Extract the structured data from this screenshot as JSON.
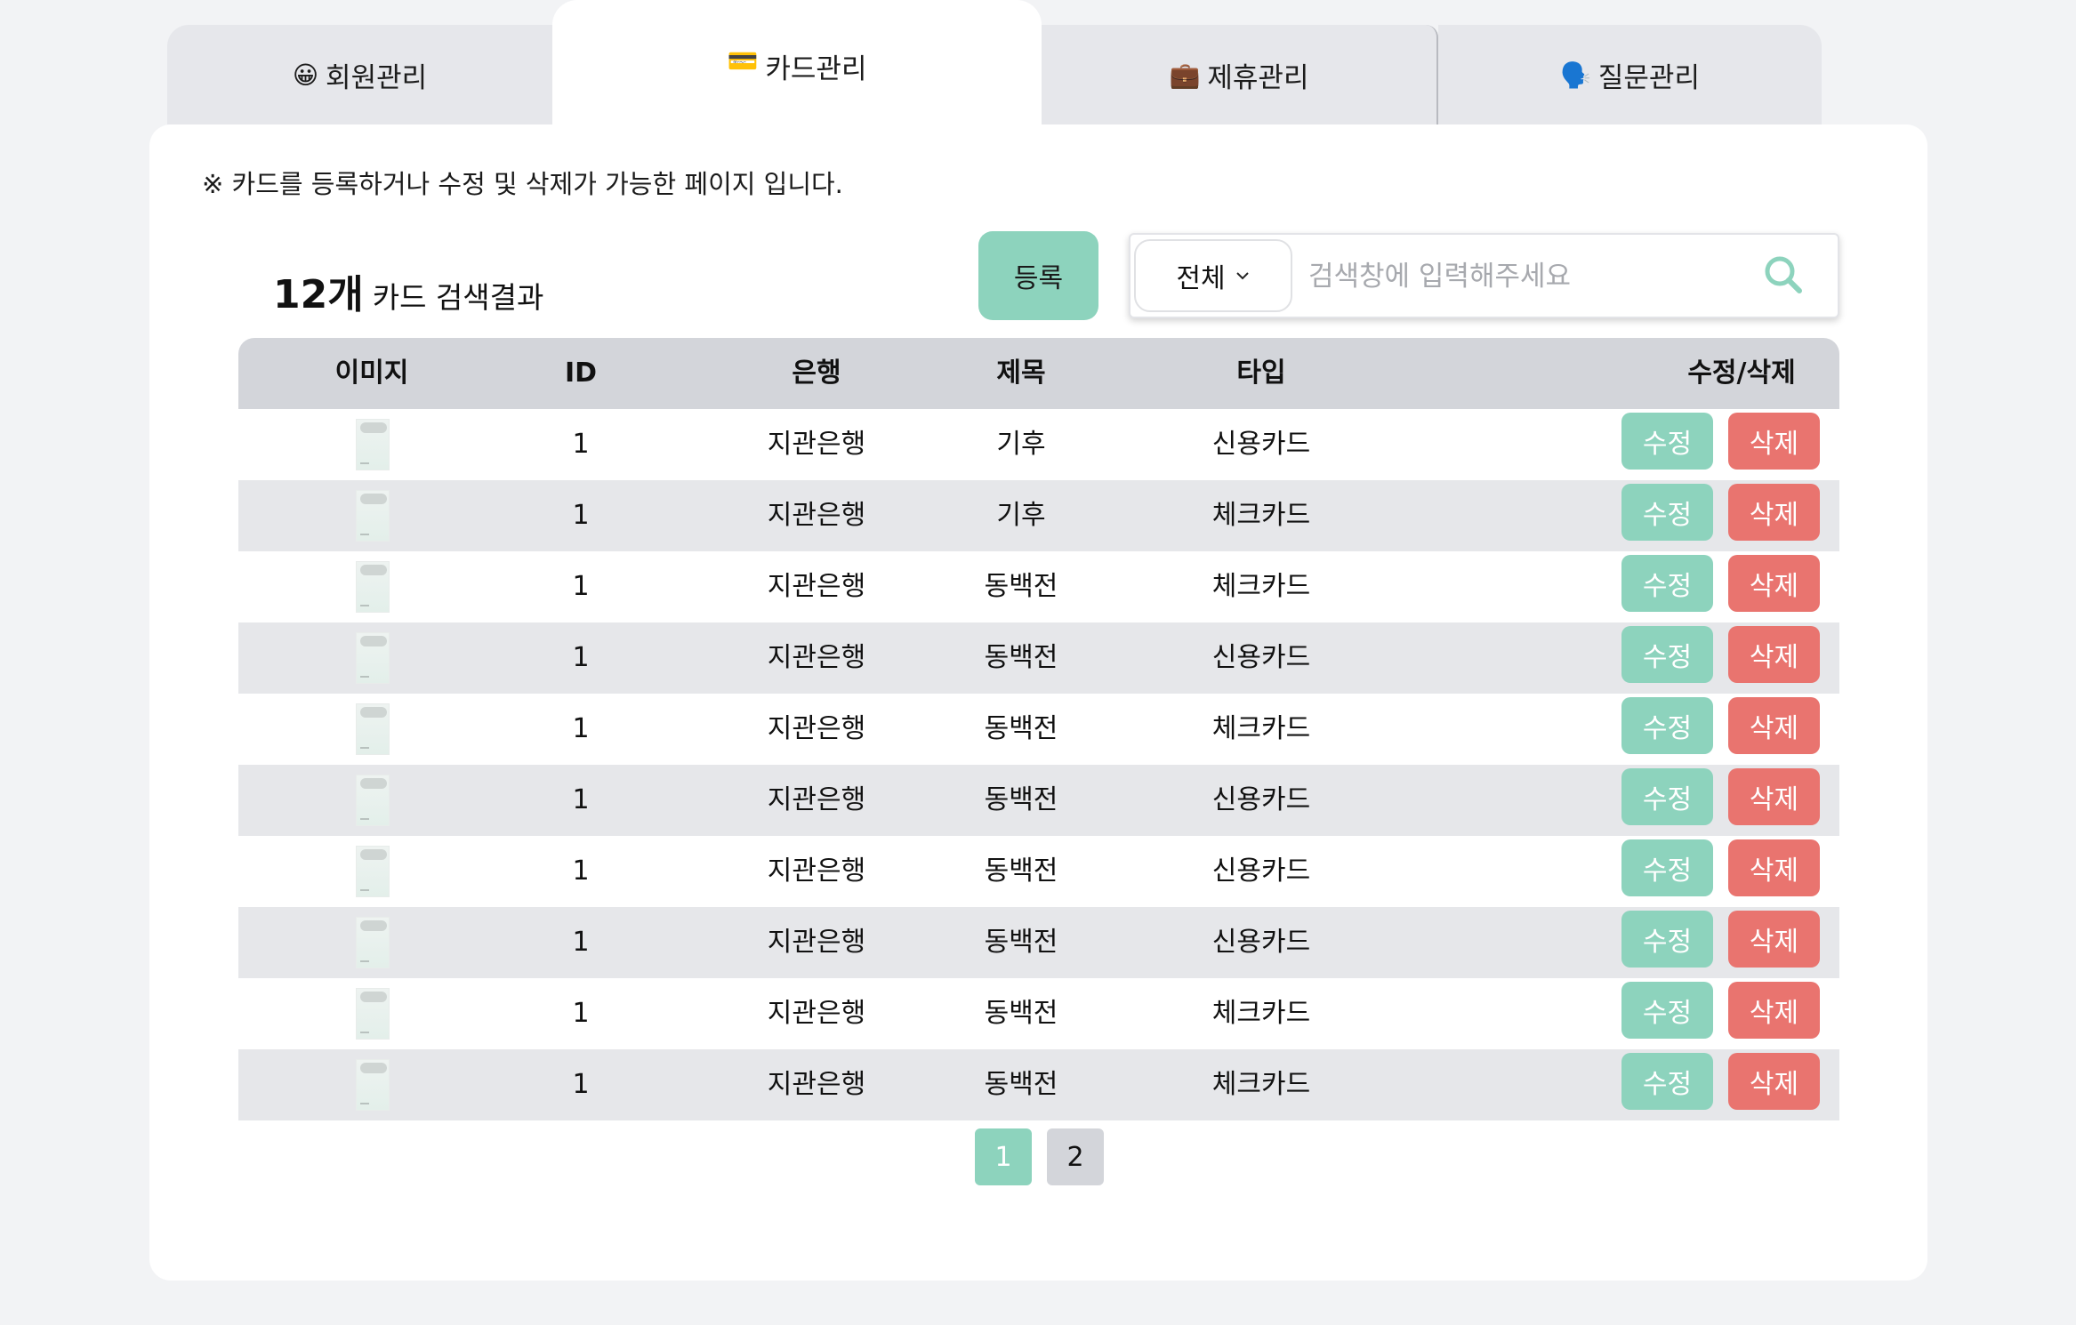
{
  "tabs": [
    {
      "icon": "😀",
      "label": "회원관리"
    },
    {
      "icon": "💳",
      "label": "카드관리"
    },
    {
      "icon": "💼",
      "label": "제휴관리"
    },
    {
      "icon": "🗣️",
      "label": "질문관리"
    }
  ],
  "notice": "※ 카드를 등록하거나 수정 및 삭제가 가능한 페이지 입니다.",
  "result": {
    "count": "12개",
    "label": "카드 검색결과"
  },
  "register_label": "등록",
  "search": {
    "filter": "전체",
    "placeholder": "검색창에 입력해주세요"
  },
  "table": {
    "headers": {
      "image": "이미지",
      "id": "ID",
      "bank": "은행",
      "title": "제목",
      "type": "타입",
      "actions": "수정/삭제"
    },
    "rows": [
      {
        "id": "1",
        "bank": "지관은행",
        "title": "기후",
        "type": "신용카드"
      },
      {
        "id": "1",
        "bank": "지관은행",
        "title": "기후",
        "type": "체크카드"
      },
      {
        "id": "1",
        "bank": "지관은행",
        "title": "동백전",
        "type": "체크카드"
      },
      {
        "id": "1",
        "bank": "지관은행",
        "title": "동백전",
        "type": "신용카드"
      },
      {
        "id": "1",
        "bank": "지관은행",
        "title": "동백전",
        "type": "체크카드"
      },
      {
        "id": "1",
        "bank": "지관은행",
        "title": "동백전",
        "type": "신용카드"
      },
      {
        "id": "1",
        "bank": "지관은행",
        "title": "동백전",
        "type": "신용카드"
      },
      {
        "id": "1",
        "bank": "지관은행",
        "title": "동백전",
        "type": "신용카드"
      },
      {
        "id": "1",
        "bank": "지관은행",
        "title": "동백전",
        "type": "체크카드"
      },
      {
        "id": "1",
        "bank": "지관은행",
        "title": "동백전",
        "type": "체크카드"
      }
    ],
    "edit_label": "수정",
    "delete_label": "삭제"
  },
  "pagination": [
    "1",
    "2"
  ],
  "colors": {
    "accent": "#8dd3bd",
    "danger": "#e9746f",
    "header_bg": "#d3d5da",
    "row_alt": "#e6e7ea"
  }
}
